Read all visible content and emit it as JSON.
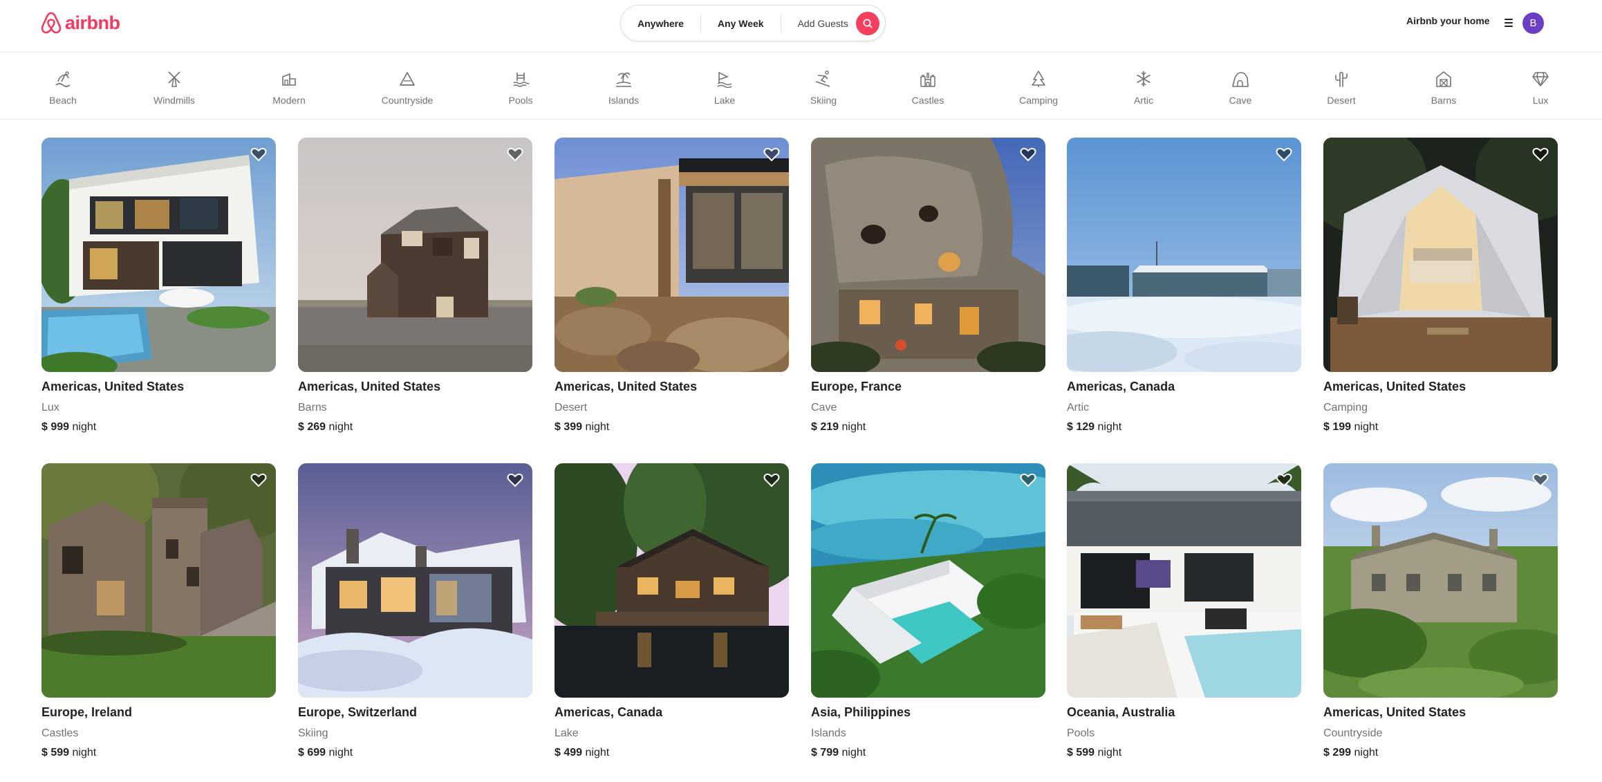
{
  "header": {
    "logo_text": "airbnb",
    "brand_color": "#F5385D",
    "search": {
      "location": "Anywhere",
      "week": "Any Week",
      "guests": "Add Guests"
    },
    "host_link": "Airbnb your home",
    "avatar_initial": "B"
  },
  "categories": [
    {
      "label": "Beach",
      "icon": "beach-icon"
    },
    {
      "label": "Windmills",
      "icon": "windmill-icon"
    },
    {
      "label": "Modern",
      "icon": "modern-icon"
    },
    {
      "label": "Countryside",
      "icon": "mountain-icon"
    },
    {
      "label": "Pools",
      "icon": "pool-icon"
    },
    {
      "label": "Islands",
      "icon": "island-icon"
    },
    {
      "label": "Lake",
      "icon": "lake-icon"
    },
    {
      "label": "Skiing",
      "icon": "skiing-icon"
    },
    {
      "label": "Castles",
      "icon": "castle-icon"
    },
    {
      "label": "Camping",
      "icon": "forest-icon"
    },
    {
      "label": "Artic",
      "icon": "snowflake-icon"
    },
    {
      "label": "Cave",
      "icon": "cave-icon"
    },
    {
      "label": "Desert",
      "icon": "cactus-icon"
    },
    {
      "label": "Barns",
      "icon": "barn-icon"
    },
    {
      "label": "Lux",
      "icon": "diamond-icon"
    }
  ],
  "listings": [
    {
      "location": "Americas, United States",
      "category": "Lux",
      "currency": "$",
      "price": "999",
      "unit": "night",
      "scene": "modern-villa-with-pool"
    },
    {
      "location": "Americas, United States",
      "category": "Barns",
      "currency": "$",
      "price": "269",
      "unit": "night",
      "scene": "dark-barn-house"
    },
    {
      "location": "Americas, United States",
      "category": "Desert",
      "currency": "$",
      "price": "399",
      "unit": "night",
      "scene": "desert-modern-home"
    },
    {
      "location": "Europe, France",
      "category": "Cave",
      "currency": "$",
      "price": "219",
      "unit": "night",
      "scene": "cave-hotel"
    },
    {
      "location": "Americas, Canada",
      "category": "Artic",
      "currency": "$",
      "price": "129",
      "unit": "night",
      "scene": "snowy-cabin"
    },
    {
      "location": "Americas, United States",
      "category": "Camping",
      "currency": "$",
      "price": "199",
      "unit": "night",
      "scene": "glamping-tent"
    },
    {
      "location": "Europe, Ireland",
      "category": "Castles",
      "currency": "$",
      "price": "599",
      "unit": "night",
      "scene": "stone-castle"
    },
    {
      "location": "Europe, Switzerland",
      "category": "Skiing",
      "currency": "$",
      "price": "699",
      "unit": "night",
      "scene": "ski-chalet"
    },
    {
      "location": "Americas, Canada",
      "category": "Lake",
      "currency": "$",
      "price": "499",
      "unit": "night",
      "scene": "lake-cabin"
    },
    {
      "location": "Asia, Philippines",
      "category": "Islands",
      "currency": "$",
      "price": "799",
      "unit": "night",
      "scene": "island-villa"
    },
    {
      "location": "Oceania, Australia",
      "category": "Pools",
      "currency": "$",
      "price": "599",
      "unit": "night",
      "scene": "pool-house"
    },
    {
      "location": "Americas, United States",
      "category": "Countryside",
      "currency": "$",
      "price": "299",
      "unit": "night",
      "scene": "country-cottage"
    }
  ]
}
